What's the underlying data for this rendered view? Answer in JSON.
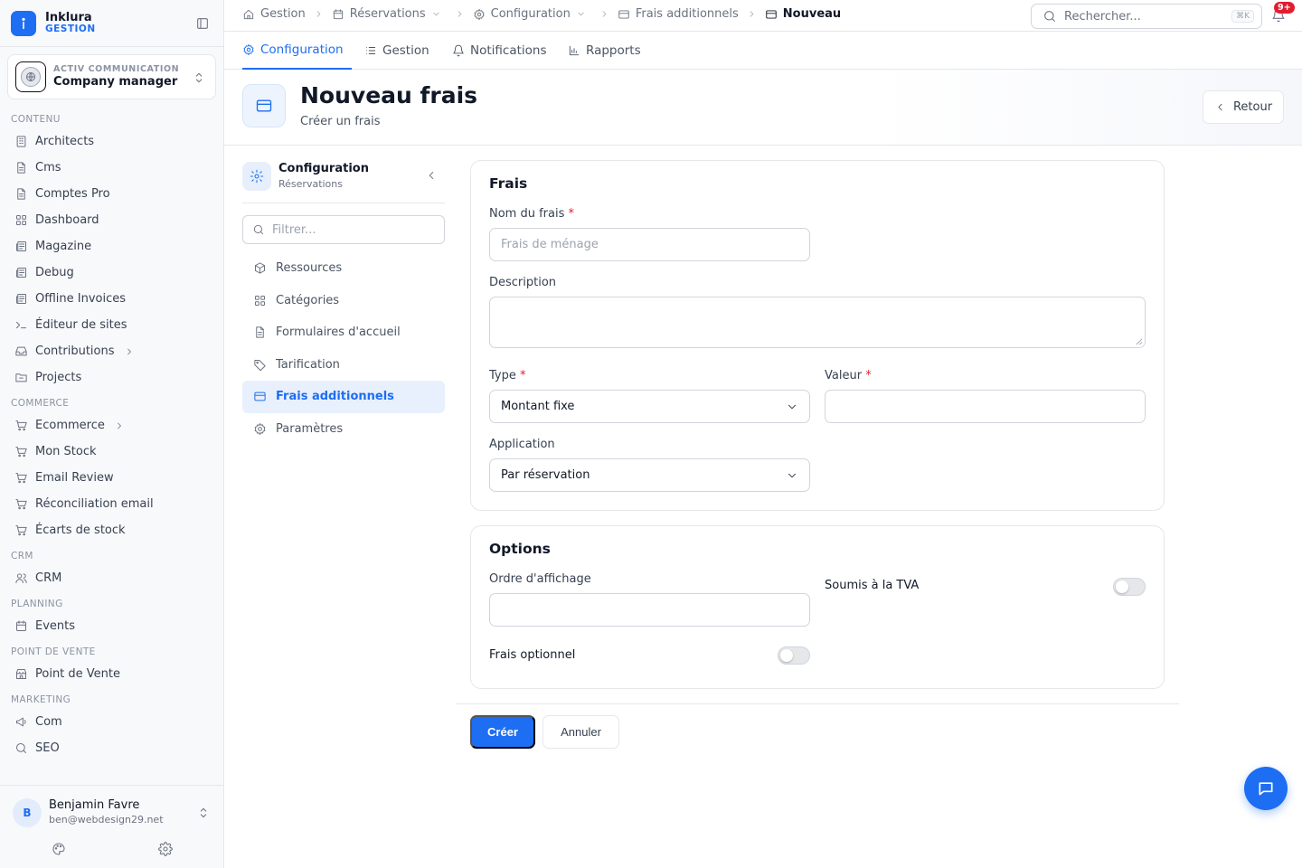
{
  "brand": {
    "name": "Inklura",
    "sub": "GESTION",
    "accent": "#1d6ef2"
  },
  "org": {
    "label": "ACTIV COMMUNICATION",
    "name": "Company manager"
  },
  "sidebar": {
    "sections": [
      {
        "title": "CONTENU",
        "items": [
          {
            "label": "Architects",
            "icon": "building-icon"
          },
          {
            "label": "Cms",
            "icon": "file-icon"
          },
          {
            "label": "Comptes Pro",
            "icon": "file-icon"
          },
          {
            "label": "Dashboard",
            "icon": "grid-icon"
          },
          {
            "label": "Magazine",
            "icon": "newspaper-icon"
          },
          {
            "label": "Debug",
            "icon": "newspaper-icon"
          },
          {
            "label": "Offline Invoices",
            "icon": "newspaper-icon"
          },
          {
            "label": "Éditeur de sites",
            "icon": "terminal-icon"
          },
          {
            "label": "Contributions",
            "icon": "inbox-icon",
            "has_arrow": true
          },
          {
            "label": "Projects",
            "icon": "folder-icon"
          }
        ]
      },
      {
        "title": "COMMERCE",
        "items": [
          {
            "label": "Ecommerce",
            "icon": "cart-icon",
            "has_arrow": true
          },
          {
            "label": "Mon Stock",
            "icon": "cart-icon"
          },
          {
            "label": "Email Review",
            "icon": "cart-icon"
          },
          {
            "label": "Réconciliation email",
            "icon": "cart-icon"
          },
          {
            "label": "Écarts de stock",
            "icon": "cart-icon"
          }
        ]
      },
      {
        "title": "CRM",
        "items": [
          {
            "label": "CRM",
            "icon": "users-icon"
          }
        ]
      },
      {
        "title": "PLANNING",
        "items": [
          {
            "label": "Events",
            "icon": "calendar-icon"
          }
        ]
      },
      {
        "title": "POINT DE VENTE",
        "items": [
          {
            "label": "Point de Vente",
            "icon": "store-icon"
          }
        ]
      },
      {
        "title": "MARKETING",
        "items": [
          {
            "label": "Com",
            "icon": "megaphone-icon"
          },
          {
            "label": "SEO",
            "icon": "search-icon"
          }
        ]
      }
    ]
  },
  "user": {
    "initial": "B",
    "name": "Benjamin Favre",
    "email": "ben@webdesign29.net"
  },
  "breadcrumb": {
    "items": [
      {
        "label": "Gestion",
        "icon": "home-icon"
      },
      {
        "label": "Réservations",
        "icon": "calendar-icon",
        "dropdown": true
      },
      {
        "label": "Configuration",
        "icon": "gear-icon",
        "dropdown": true
      },
      {
        "label": "Frais additionnels",
        "icon": "card-icon"
      },
      {
        "label": "Nouveau",
        "icon": "card-icon",
        "current": true
      }
    ]
  },
  "search": {
    "placeholder": "Rechercher...",
    "shortcut": "⌘K"
  },
  "notifications": {
    "badge": "9+"
  },
  "tabs": [
    {
      "label": "Configuration",
      "icon": "gear-icon",
      "active": true
    },
    {
      "label": "Gestion",
      "icon": "list-icon"
    },
    {
      "label": "Notifications",
      "icon": "bell-icon"
    },
    {
      "label": "Rapports",
      "icon": "bar-chart-icon"
    }
  ],
  "page": {
    "title": "Nouveau frais",
    "subtitle": "Créer un frais",
    "back_label": "Retour"
  },
  "subnav": {
    "title": "Configuration",
    "subtitle": "Réservations",
    "filter_placeholder": "Filtrer...",
    "items": [
      {
        "label": "Ressources",
        "icon": "box-icon"
      },
      {
        "label": "Catégories",
        "icon": "grid-icon"
      },
      {
        "label": "Formulaires d'accueil",
        "icon": "file-icon"
      },
      {
        "label": "Tarification",
        "icon": "tag-icon"
      },
      {
        "label": "Frais additionnels",
        "icon": "card-icon",
        "active": true
      },
      {
        "label": "Paramètres",
        "icon": "gear-icon"
      }
    ]
  },
  "form": {
    "frais": {
      "title": "Frais",
      "name_label": "Nom du frais",
      "name_placeholder": "Frais de ménage",
      "name_value": "",
      "description_label": "Description",
      "description_value": "",
      "type_label": "Type",
      "type_value": "Montant fixe",
      "valeur_label": "Valeur",
      "valeur_value": "",
      "application_label": "Application",
      "application_value": "Par réservation",
      "required_mark": "*"
    },
    "options": {
      "title": "Options",
      "ordre_label": "Ordre d'affichage",
      "ordre_value": "",
      "tva_label": "Soumis à la TVA",
      "tva_on": false,
      "optionnel_label": "Frais optionnel",
      "optionnel_on": false
    },
    "submit_label": "Créer",
    "cancel_label": "Annuler"
  }
}
